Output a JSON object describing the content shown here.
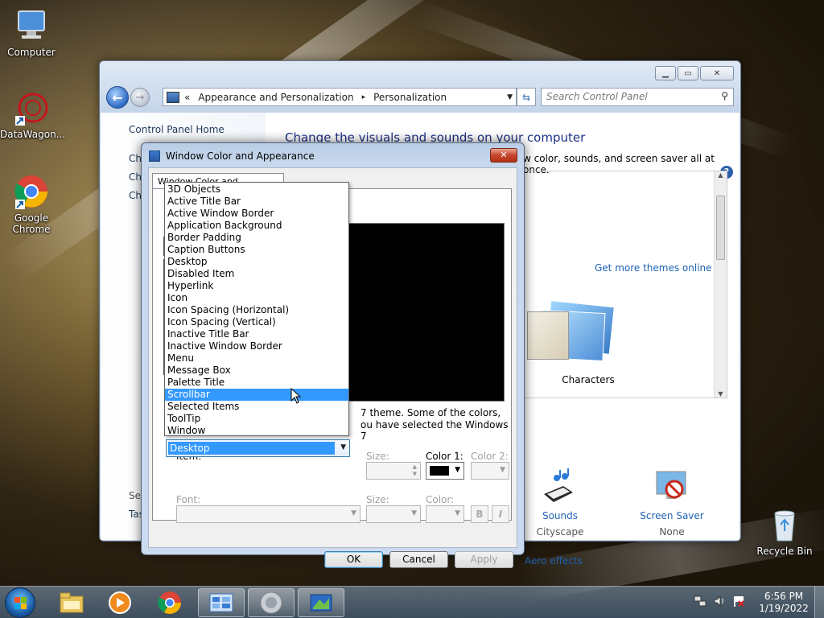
{
  "desktop": {
    "icons": [
      {
        "label": "Computer"
      },
      {
        "label": "DataWagon..."
      },
      {
        "label": "Google Chrome"
      },
      {
        "label": "Recycle Bin"
      }
    ]
  },
  "control_panel": {
    "breadcrumb": {
      "prefix": "«",
      "level1": "Appearance and Personalization",
      "separator": "▸",
      "level2": "Personalization"
    },
    "search_placeholder": "Search Control Panel",
    "left_links": {
      "home": "Control Panel Home",
      "ch1": "Ch",
      "ch2": "Ch",
      "ch3": "Ch",
      "see_also": "See",
      "taskbar": "Tas"
    },
    "heading": "Change the visuals and sounds on your computer",
    "subtext": "w color, sounds, and screen saver all at once.",
    "more_themes_link": "Get more themes online",
    "theme_name": "Characters",
    "sounds": {
      "label": "Sounds",
      "value": "Cityscape"
    },
    "screensaver": {
      "label": "Screen Saver",
      "value": "None"
    },
    "aero_link": "Aero effects"
  },
  "dialog": {
    "title": "Window Color and Appearance",
    "close_glyph": "✕",
    "tab_label": "Window Color and Appearance",
    "preview": {
      "minimize": "_",
      "maximize": "□",
      "close": "✕",
      "scroll_up": "▲",
      "scroll_down": "▼"
    },
    "info_line1": "7 theme.  Some of the colors,",
    "info_line2": "ou have selected the Windows 7",
    "item_label": "Item:",
    "item_value": "Desktop",
    "size_label": "Size:",
    "color1_label": "Color 1:",
    "color2_label": "Color 2:",
    "font_label": "Font:",
    "font_size_label": "Size:",
    "font_color_label": "Color:",
    "bold_label": "B",
    "italic_label": "I",
    "buttons": {
      "ok": "OK",
      "cancel": "Cancel",
      "apply": "Apply"
    },
    "color1_value": "#000000"
  },
  "item_dropdown": {
    "options": [
      "3D Objects",
      "Active Title Bar",
      "Active Window Border",
      "Application Background",
      "Border Padding",
      "Caption Buttons",
      "Desktop",
      "Disabled Item",
      "Hyperlink",
      "Icon",
      "Icon Spacing (Horizontal)",
      "Icon Spacing (Vertical)",
      "Inactive Title Bar",
      "Inactive Window Border",
      "Menu",
      "Message Box",
      "Palette Title",
      "Scrollbar",
      "Selected Items",
      "ToolTip",
      "Window"
    ],
    "highlighted": "Scrollbar"
  },
  "taskbar": {
    "time": "6:56 PM",
    "date": "1/19/2022"
  },
  "colors": {
    "accent": "#3399ff",
    "link": "#1e3287",
    "title_blue": "#c8d8ec"
  }
}
